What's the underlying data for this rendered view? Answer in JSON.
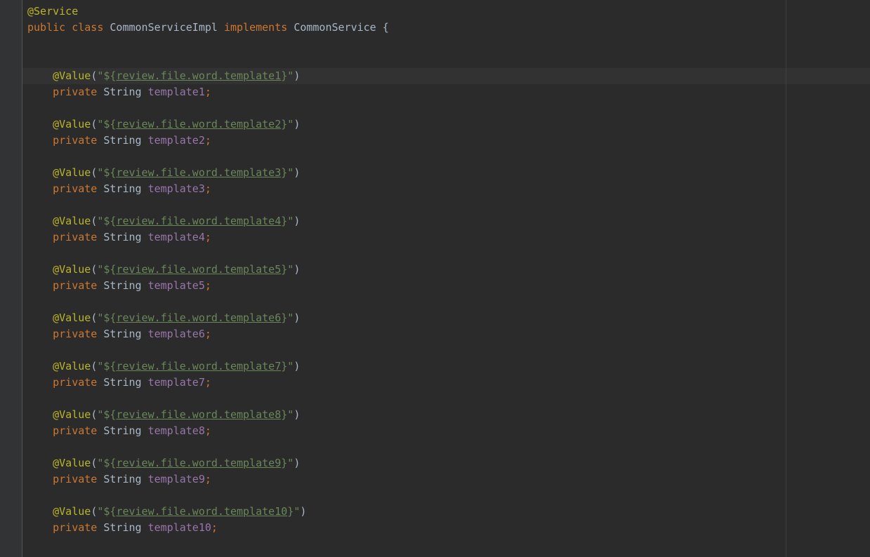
{
  "code": {
    "class_annotation": "@Service",
    "class_decl": {
      "public_kw": "public",
      "class_kw": "class",
      "class_name": "CommonServiceImpl",
      "implements_kw": "implements",
      "interface_name": "CommonService",
      "brace": "{"
    },
    "fields": [
      {
        "annotation": "@Value",
        "open": "(\"",
        "prop_open": "${",
        "prop": "review.file.word.template1",
        "prop_close": "}",
        "close": "\")",
        "modifier": "private",
        "type": "String",
        "name": "template1",
        "semicolon": ";"
      },
      {
        "annotation": "@Value",
        "open": "(\"",
        "prop_open": "${",
        "prop": "review.file.word.template2",
        "prop_close": "}",
        "close": "\")",
        "modifier": "private",
        "type": "String",
        "name": "template2",
        "semicolon": ";"
      },
      {
        "annotation": "@Value",
        "open": "(\"",
        "prop_open": "${",
        "prop": "review.file.word.template3",
        "prop_close": "}",
        "close": "\")",
        "modifier": "private",
        "type": "String",
        "name": "template3",
        "semicolon": ";"
      },
      {
        "annotation": "@Value",
        "open": "(\"",
        "prop_open": "${",
        "prop": "review.file.word.template4",
        "prop_close": "}",
        "close": "\")",
        "modifier": "private",
        "type": "String",
        "name": "template4",
        "semicolon": ";"
      },
      {
        "annotation": "@Value",
        "open": "(\"",
        "prop_open": "${",
        "prop": "review.file.word.template5",
        "prop_close": "}",
        "close": "\")",
        "modifier": "private",
        "type": "String",
        "name": "template5",
        "semicolon": ";"
      },
      {
        "annotation": "@Value",
        "open": "(\"",
        "prop_open": "${",
        "prop": "review.file.word.template6",
        "prop_close": "}",
        "close": "\")",
        "modifier": "private",
        "type": "String",
        "name": "template6",
        "semicolon": ";"
      },
      {
        "annotation": "@Value",
        "open": "(\"",
        "prop_open": "${",
        "prop": "review.file.word.template7",
        "prop_close": "}",
        "close": "\")",
        "modifier": "private",
        "type": "String",
        "name": "template7",
        "semicolon": ";"
      },
      {
        "annotation": "@Value",
        "open": "(\"",
        "prop_open": "${",
        "prop": "review.file.word.template8",
        "prop_close": "}",
        "close": "\")",
        "modifier": "private",
        "type": "String",
        "name": "template8",
        "semicolon": ";"
      },
      {
        "annotation": "@Value",
        "open": "(\"",
        "prop_open": "${",
        "prop": "review.file.word.template9",
        "prop_close": "}",
        "close": "\")",
        "modifier": "private",
        "type": "String",
        "name": "template9",
        "semicolon": ";"
      },
      {
        "annotation": "@Value",
        "open": "(\"",
        "prop_open": "${",
        "prop": "review.file.word.template10",
        "prop_close": "}",
        "close": "\")",
        "modifier": "private",
        "type": "String",
        "name": "template10",
        "semicolon": ";"
      }
    ]
  },
  "theme": {
    "background": "#2b2b2b",
    "keyword": "#cc7832",
    "annotation": "#bbb529",
    "string": "#6a8759",
    "field": "#9876aa",
    "text": "#a9b7c6"
  }
}
